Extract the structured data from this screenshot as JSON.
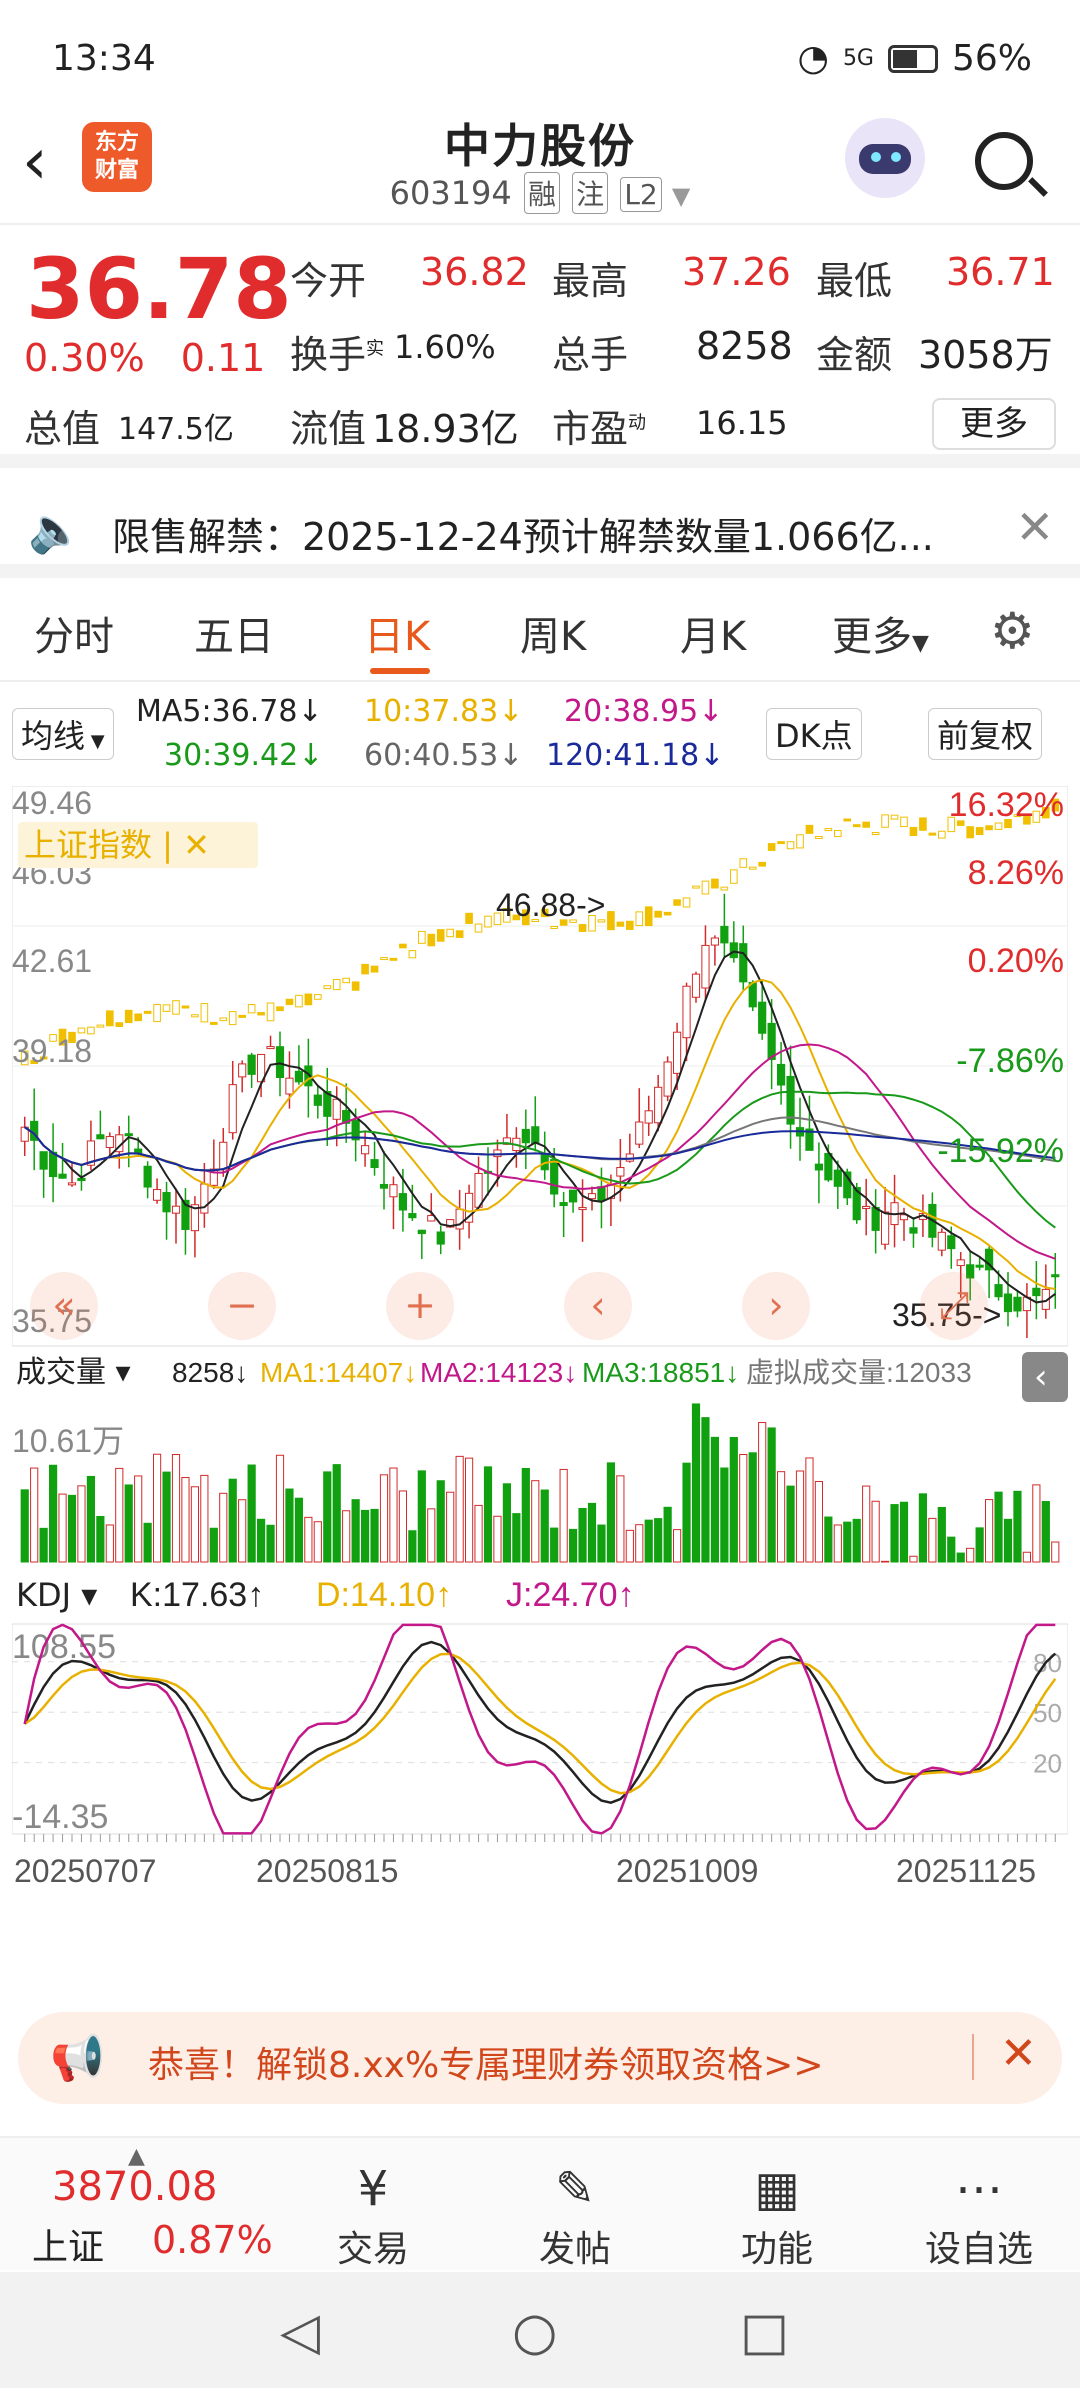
{
  "status": {
    "time": "13:34",
    "battery": "56%",
    "network": "5G"
  },
  "header": {
    "title": "中力股份",
    "code": "603194",
    "tags": [
      "融",
      "注",
      "L2"
    ],
    "logo_text": "东方财富"
  },
  "quote": {
    "price": "36.78",
    "change_pct": "0.30%",
    "change": "0.11",
    "open_label": "今开",
    "open": "36.82",
    "high_label": "最高",
    "high": "37.26",
    "low_label": "最低",
    "low": "36.71",
    "turnover_label": "换手",
    "turnover": "1.60%",
    "volume_label": "总手",
    "volume": "8258",
    "amount_label": "金额",
    "amount": "3058万",
    "mktcap_label": "总值",
    "mktcap": "147.5亿",
    "float_label": "流值",
    "float": "18.93亿",
    "pe_label": "市盈",
    "pe": "16.15",
    "more": "更多"
  },
  "notice": {
    "text": "限售解禁：2025-12-24预计解禁数量1.066亿..."
  },
  "tabs": [
    "分时",
    "五日",
    "日K",
    "周K",
    "月K",
    "更多"
  ],
  "ma_row": {
    "selector": "均线",
    "ma5": "MA5:36.78↓",
    "ma10": "10:37.83↓",
    "ma20": "20:38.95↓",
    "ma30": "30:39.42↓",
    "ma60": "60:40.53↓",
    "ma120": "120:41.18↓",
    "dk": "DK点",
    "adjust": "前复权"
  },
  "kline": {
    "y_labels": [
      "49.46",
      "46.03",
      "42.61",
      "39.18",
      "35.75"
    ],
    "pct_labels": [
      "16.32%",
      "8.26%",
      "0.20%",
      "-7.86%",
      "-15.92%"
    ],
    "index_label": "上证指数",
    "high_mark": "46.88->",
    "low_mark": "35.75->"
  },
  "volume": {
    "selector": "成交量",
    "value": "8258↓",
    "ma1": "MA1:14407↓",
    "ma2": "MA2:14123↓",
    "ma3": "MA3:18851↓",
    "virtual": "虚拟成交量:12033",
    "max": "10.61万"
  },
  "kdj": {
    "selector": "KDJ",
    "k": "K:17.63↑",
    "d": "D:14.10↑",
    "j": "J:24.70↑",
    "max": "108.55",
    "min": "-14.35",
    "lines": [
      "80",
      "50",
      "20"
    ]
  },
  "dates": [
    "20250707",
    "20250815",
    "20251009",
    "20251125"
  ],
  "ad": {
    "text": "恭喜！解锁8.xx%专属理财券领取资格>>"
  },
  "bottom": {
    "index_value": "3870.08",
    "index_name": "上证",
    "index_pct": "0.87%",
    "items": [
      "交易",
      "发帖",
      "功能",
      "设自选"
    ]
  },
  "chart_data": {
    "type": "candlestick",
    "price_range": [
      35.75,
      49.46
    ],
    "ma_lines": [
      "MA5",
      "MA10",
      "MA20",
      "MA30",
      "MA60",
      "MA120"
    ],
    "high": 46.88,
    "low": 35.75,
    "close": 36.78,
    "x": [
      "20250707",
      "20250815",
      "20251009",
      "20251125"
    ],
    "volume_max": 106100,
    "kdj_range": [
      -14.35,
      108.55
    ]
  }
}
